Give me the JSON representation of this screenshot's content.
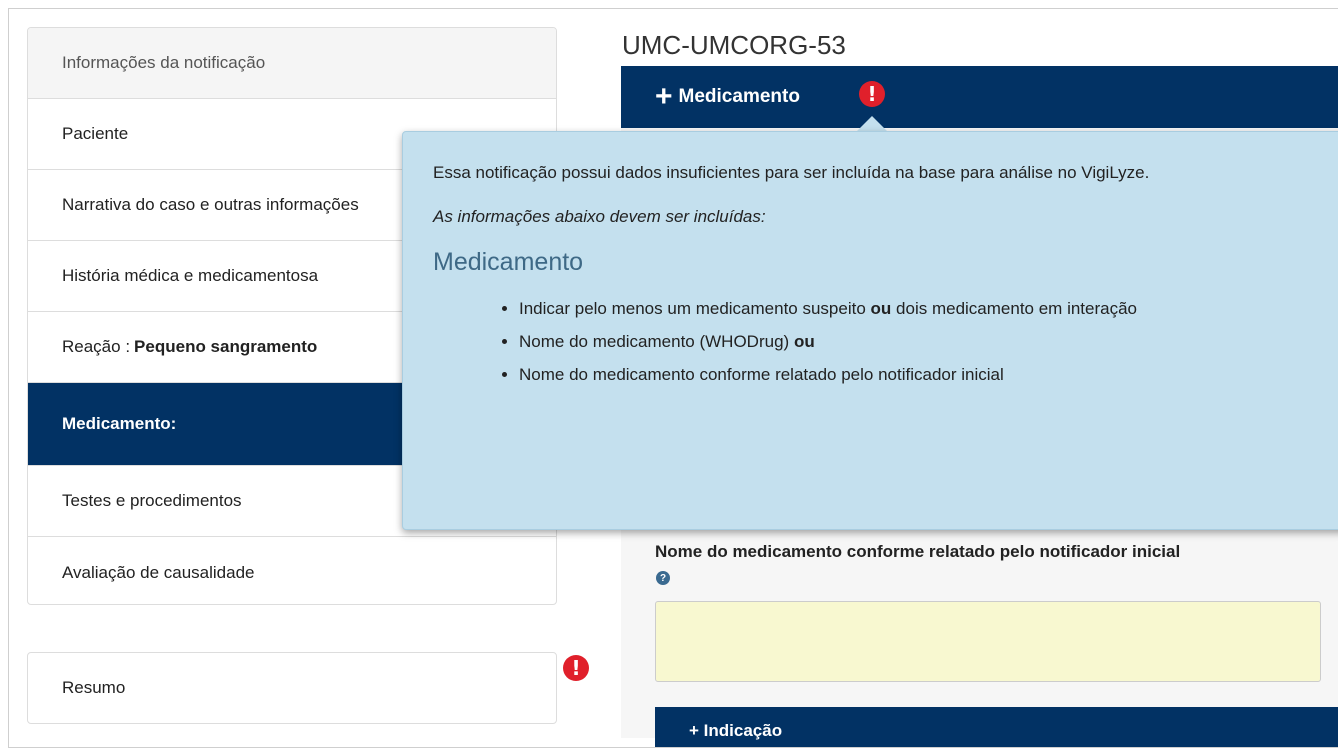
{
  "sidebar": {
    "items": [
      {
        "label": "Informações da notificação"
      },
      {
        "label": "Paciente"
      },
      {
        "label": "Narrativa do caso e outras informações"
      },
      {
        "label": "História médica e medicamentosa"
      },
      {
        "label": "Reação :",
        "value": "Pequeno sangramento"
      },
      {
        "label": "Medicamento:"
      },
      {
        "label": "Testes e procedimentos"
      },
      {
        "label": "Avaliação de causalidade"
      }
    ],
    "summary_label": "Resumo"
  },
  "main": {
    "record_id": "UMC-UMCORG-53",
    "section_title": "Medicamento",
    "field_label": "Nome do medicamento conforme relatado pelo notificador inicial",
    "field_value": "",
    "next_section_title": "Indicação"
  },
  "popover": {
    "intro": "Essa notificação possui dados insuficientes para ser incluída na base para análise no VigiLyze.",
    "subtitle": "As informações abaixo devem ser incluídas:",
    "heading": "Medicamento",
    "bullets": [
      {
        "pre": "Indicar pelo menos um medicamento suspeito",
        "bold": "ou",
        "post": "dois medicamento em interação"
      },
      {
        "pre": "Nome do medicamento (WHODrug)",
        "bold": "ou",
        "post": ""
      },
      {
        "pre": "Nome do medicamento conforme relatado pelo notificador inicial",
        "bold": "",
        "post": ""
      }
    ]
  },
  "icons": {
    "alert": "exclamation-circle-icon",
    "help": "question-circle-icon",
    "plus": "plus-icon"
  },
  "colors": {
    "nav_active": "#023264",
    "popover_bg": "#c4e0ee",
    "alert": "#e0202b",
    "input_bg": "#f8f8d0"
  }
}
